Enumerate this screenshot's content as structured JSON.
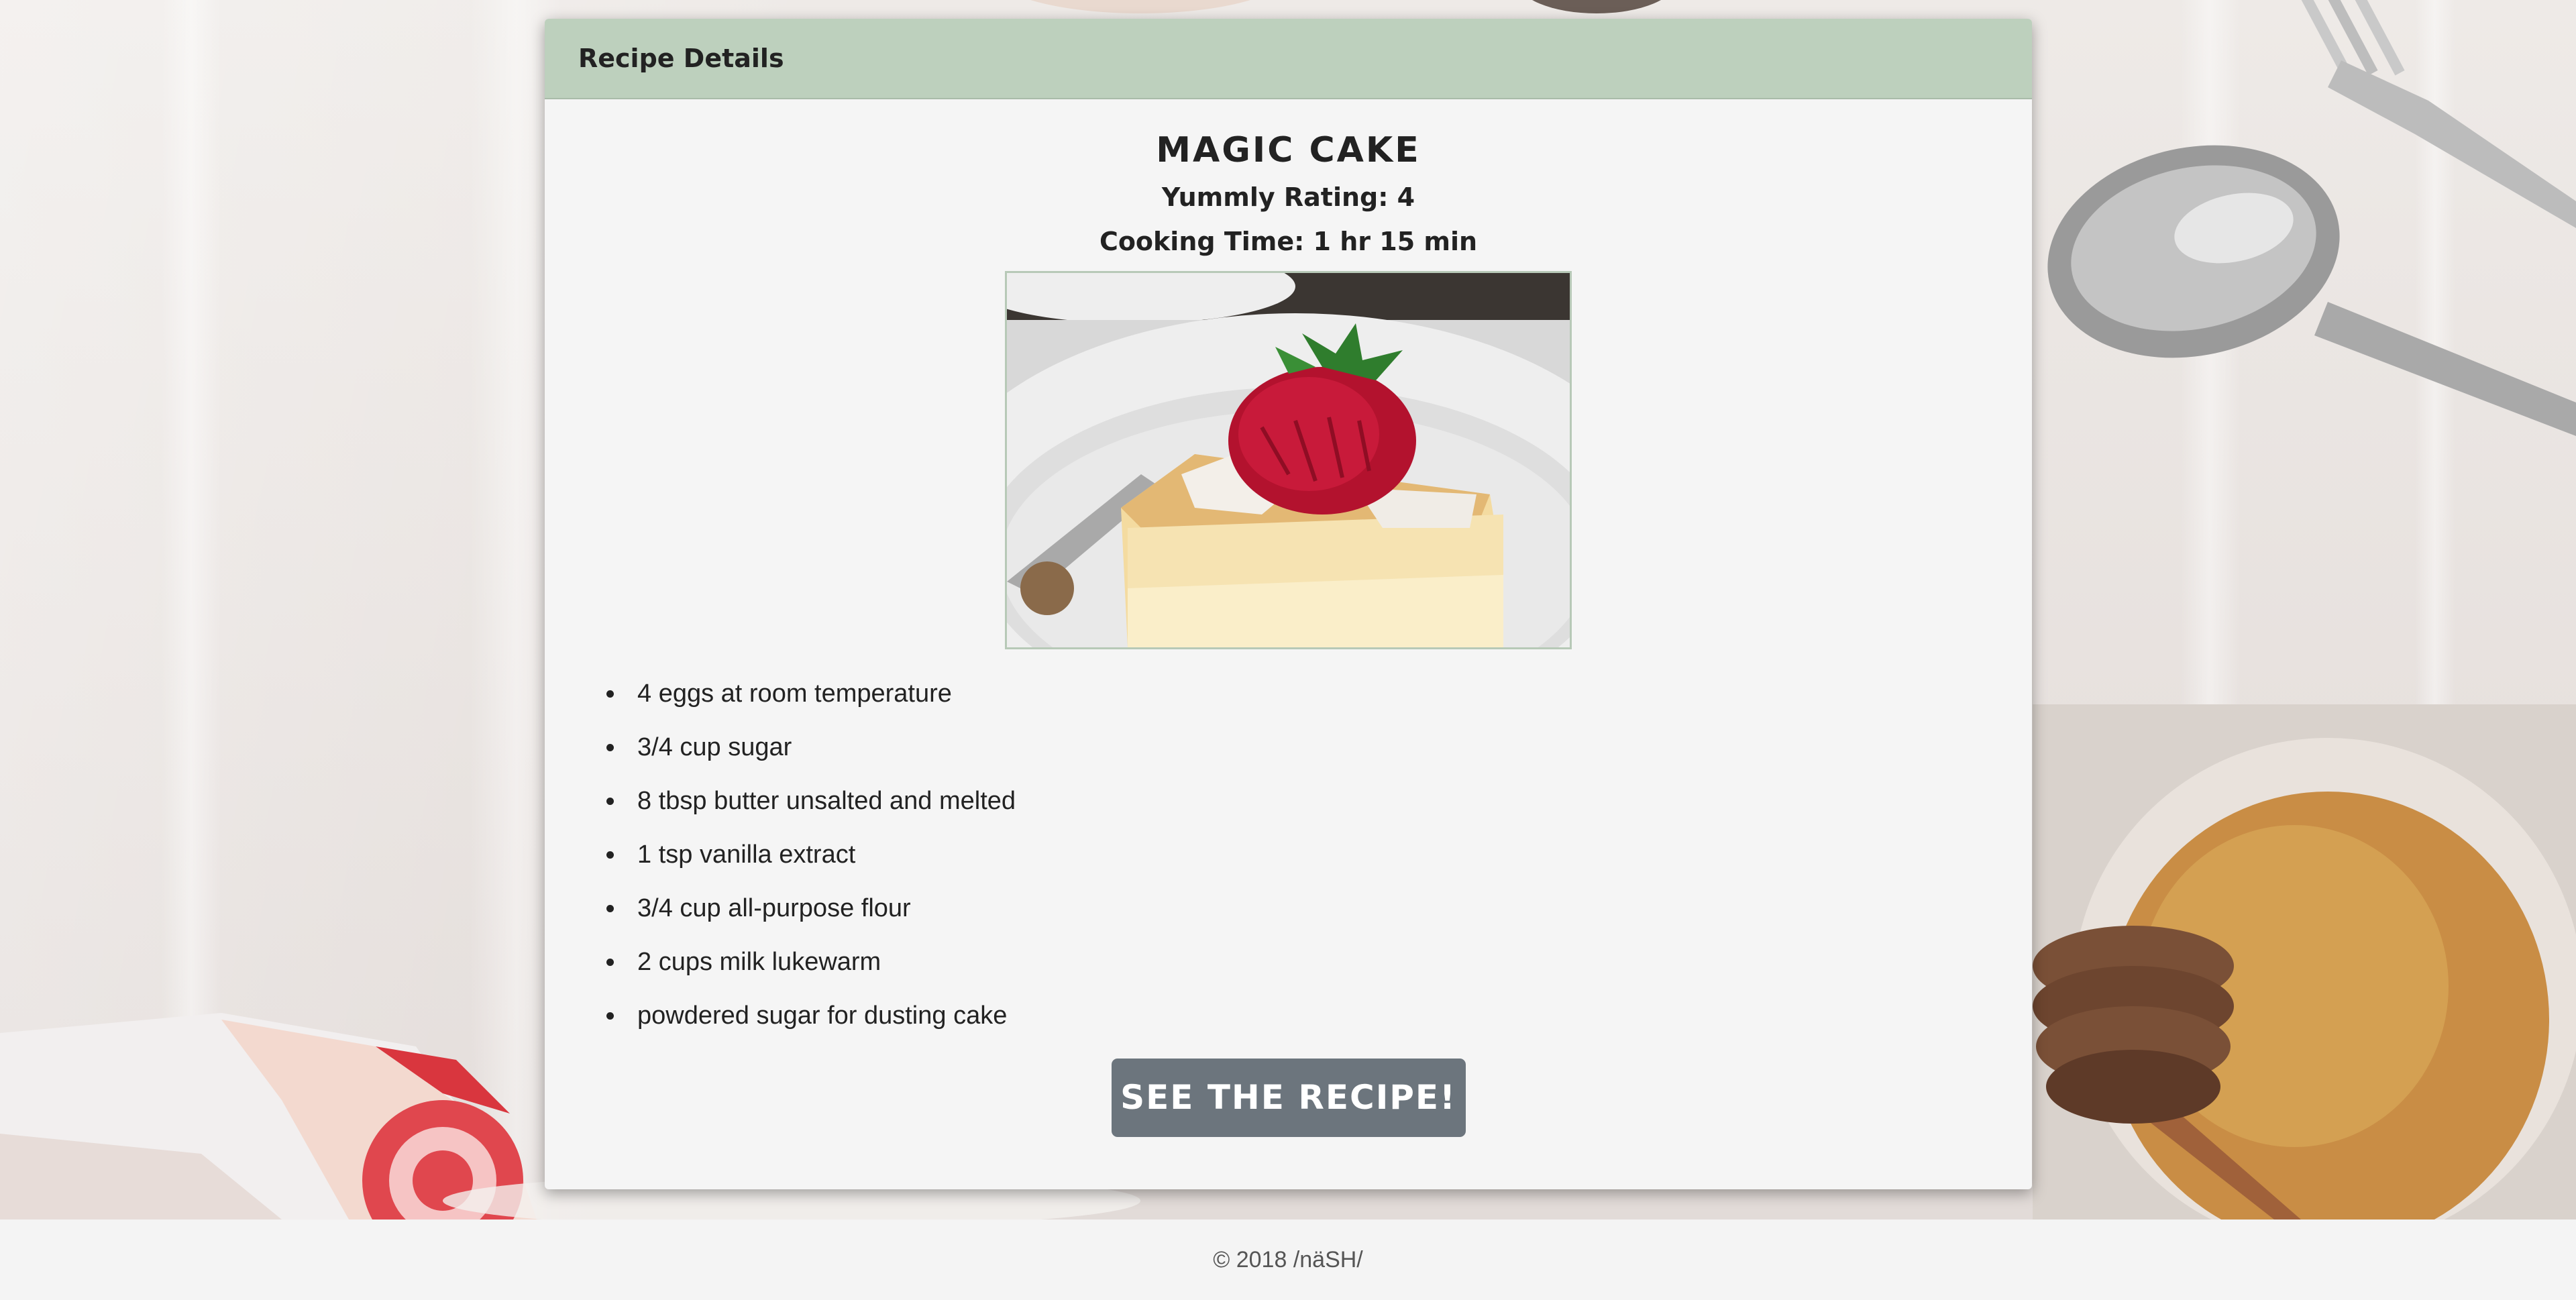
{
  "card": {
    "header_title": "Recipe Details"
  },
  "recipe": {
    "name": "Magic Cake",
    "rating_text": "Yummly Rating: 4",
    "cooking_time_text": "Cooking Time: 1 hr 15 min",
    "ingredients": [
      "4 eggs at room temperature",
      "3/4 cup sugar",
      "8 tbsp butter unsalted and melted",
      "1 tsp vanilla extract",
      "3/4 cup all-purpose flour",
      "2 cups milk lukewarm",
      "powdered sugar for dusting cake"
    ],
    "button_label": "See the recipe!"
  },
  "footer": {
    "copyright": "© 2018 /näSH/"
  },
  "colors": {
    "header_bg": "#bdd0bd",
    "button_bg": "#6c757d",
    "card_bg": "#f5f5f5"
  }
}
